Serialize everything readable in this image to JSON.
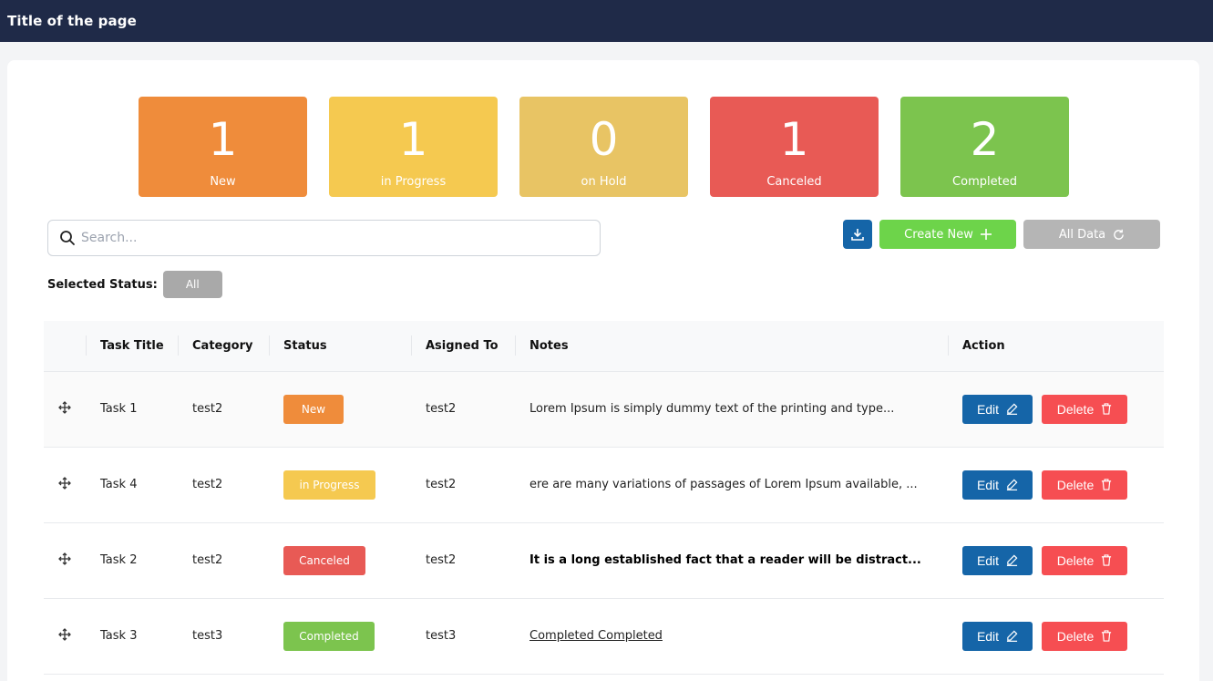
{
  "header": {
    "title": "Title of the page"
  },
  "summary_cards": [
    {
      "value": "1",
      "label": "New",
      "color": "#ef8c3b"
    },
    {
      "value": "1",
      "label": "in Progress",
      "color": "#f5c950"
    },
    {
      "value": "0",
      "label": "on Hold",
      "color": "#e8c464"
    },
    {
      "value": "1",
      "label": "Canceled",
      "color": "#e85a55"
    },
    {
      "value": "2",
      "label": "Completed",
      "color": "#7cc44e"
    }
  ],
  "search": {
    "placeholder": "Search...",
    "icon": "search-icon"
  },
  "toolbar": {
    "download_icon": "download-icon",
    "create_label": "Create New",
    "all_data_label": "All Data"
  },
  "filter": {
    "label": "Selected Status:",
    "value": "All"
  },
  "table": {
    "columns": [
      "Task Title",
      "Category",
      "Status",
      "Asigned To",
      "Notes",
      "Action"
    ],
    "rows": [
      {
        "title": "Task 1",
        "category": "test2",
        "status": "New",
        "assigned": "test2",
        "notes": "Lorem Ipsum is simply dummy text of the printing and type...",
        "edit": "Edit",
        "delete": "Delete"
      },
      {
        "title": "Task 4",
        "category": "test2",
        "status": "in Progress",
        "assigned": "test2",
        "notes": "ere are many variations of passages of Lorem Ipsum available, ...",
        "edit": "Edit",
        "delete": "Delete"
      },
      {
        "title": "Task 2",
        "category": "test2",
        "status": "Canceled",
        "assigned": "test2",
        "notes": "It is a long established fact that a reader will be distract...",
        "edit": "Edit",
        "delete": "Delete"
      },
      {
        "title": "Task 3",
        "category": "test3",
        "status": "Completed",
        "assigned": "test3",
        "notes": "Completed Completed",
        "edit": "Edit",
        "delete": "Delete"
      }
    ]
  }
}
